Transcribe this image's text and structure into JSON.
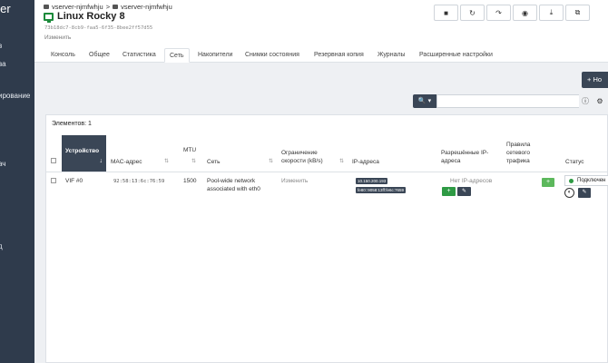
{
  "sidebar": {
    "brand": "ider",
    "items": [
      "в",
      "ва",
      "ирование",
      "ач",
      "д"
    ]
  },
  "breadcrumb": {
    "first": "vserver-njmfwhju",
    "sep": ">",
    "second": "vserver-njmfwhju"
  },
  "title": "Linux Rocky 8",
  "uuid": "73b18dc7-8cb9-faa5-6f35-8bee2ff57d55",
  "edit_label": "Изменить",
  "actions": [
    "■",
    "↻",
    "↷",
    "◉",
    "⤓",
    "⧉"
  ],
  "tabs": [
    "Консоль",
    "Общее",
    "Статистика",
    "Сеть",
    "Накопители",
    "Снимки состояния",
    "Резервная копия",
    "Журналы",
    "Расширенные настройки"
  ],
  "active_tab": "Сеть",
  "add_button": "+ Но",
  "search": {
    "dropdown": "🔍 ▾",
    "placeholder": "",
    "info_icon": "ⓘ",
    "gear_icon": "⚙"
  },
  "table": {
    "count_label": "Элементов: 1",
    "headers": {
      "device": "Устройство",
      "mac": "MAC-адрес",
      "mtu": "MTU",
      "network": "Сеть",
      "rate_line1": "Ограничение",
      "rate_line2": "скорости (kB/s)",
      "ip": "IP-адреса",
      "allowed_line1": "Разрешённые IP-",
      "allowed_line2": "адреса",
      "traffic_line1": "Правила",
      "traffic_line2": "сетевого",
      "traffic_line3": "трафика",
      "status": "Статус"
    },
    "row": {
      "device": "VIF #0",
      "mac": "92:58:13:6c:76:59",
      "mtu": "1500",
      "network_line1": "Pool-wide network",
      "network_line2": "associated with eth0",
      "rate": "Изменить",
      "ip1": "10.150.200.193",
      "ip2": "fe80::9058:13ff:fe6c:7659",
      "allowed": "Нет IP-адресов",
      "status": "Подключен"
    }
  }
}
